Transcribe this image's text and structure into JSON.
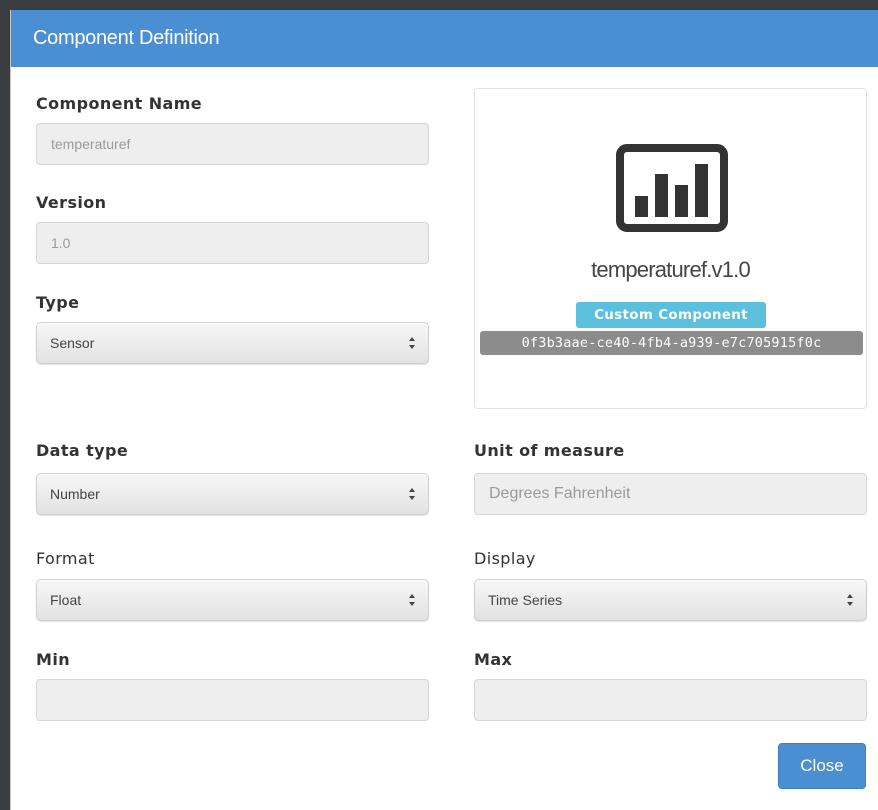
{
  "modal": {
    "title": "Component Definition",
    "close_label": "Close",
    "accent_color": "#4a8fd1"
  },
  "form": {
    "component_name": {
      "label": "Component Name",
      "placeholder": "temperaturef"
    },
    "version": {
      "label": "Version",
      "placeholder": "1.0"
    },
    "type": {
      "label": "Type",
      "selected": "Sensor"
    },
    "data_type": {
      "label": "Data type",
      "selected": "Number"
    },
    "unit_of_measure": {
      "label": "Unit of measure",
      "placeholder": "Degrees Fahrenheit"
    },
    "format": {
      "label": "Format",
      "selected": "Float"
    },
    "display": {
      "label": "Display",
      "selected": "Time Series"
    },
    "min": {
      "label": "Min",
      "value": ""
    },
    "max": {
      "label": "Max",
      "value": ""
    }
  },
  "preview": {
    "icon": "bar-chart-icon",
    "name": "temperaturef.v1.0",
    "badge": "Custom Component",
    "badge_color": "#5bc0de",
    "uuid": "0f3b3aae-ce40-4fb4-a939-e7c705915f0c"
  }
}
